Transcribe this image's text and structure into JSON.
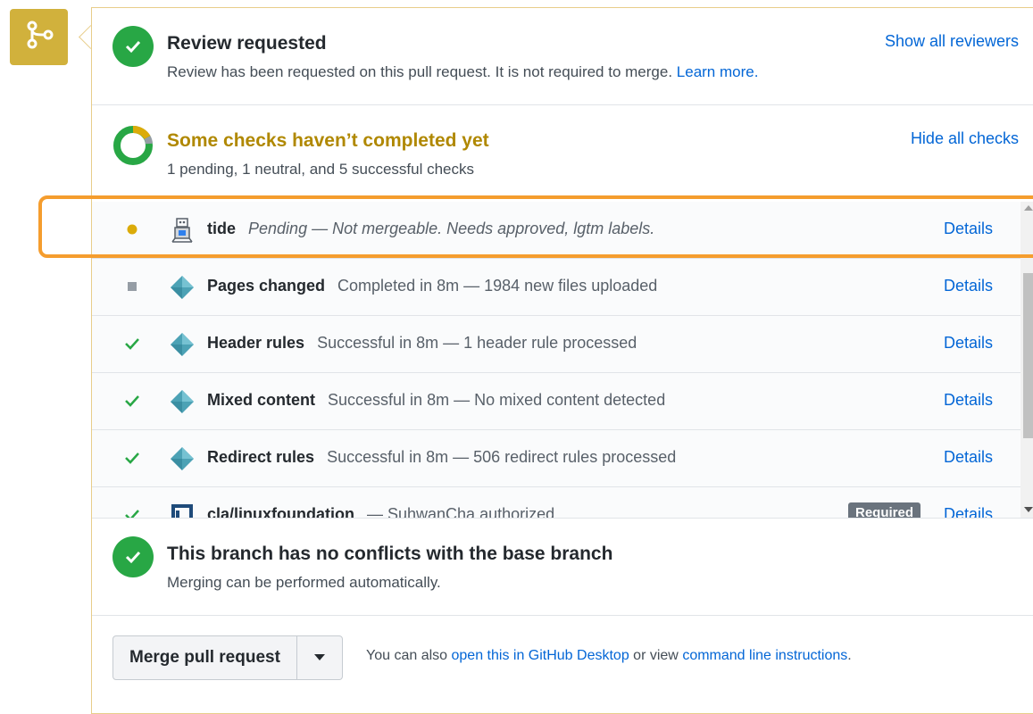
{
  "review": {
    "title": "Review requested",
    "subtitle": "Review has been requested on this pull request. It is not required to merge.",
    "learn_more": "Learn more.",
    "show_all": "Show all reviewers"
  },
  "checks_summary": {
    "title": "Some checks haven’t completed yet",
    "subtitle": "1 pending, 1 neutral, and 5 successful checks",
    "hide_all": "Hide all checks"
  },
  "checks": [
    {
      "name": "tide",
      "description": "Pending — Not mergeable. Needs approved, lgtm labels.",
      "status": "pending",
      "details": "Details"
    },
    {
      "name": "Pages changed",
      "description": "Completed in 8m — 1984 new files uploaded",
      "status": "neutral",
      "details": "Details"
    },
    {
      "name": "Header rules",
      "description": "Successful in 8m — 1 header rule processed",
      "status": "success",
      "details": "Details"
    },
    {
      "name": "Mixed content",
      "description": "Successful in 8m — No mixed content detected",
      "status": "success",
      "details": "Details"
    },
    {
      "name": "Redirect rules",
      "description": "Successful in 8m — 506 redirect rules processed",
      "status": "success",
      "details": "Details"
    },
    {
      "name": "cla/linuxfoundation",
      "description": "— SuhwanCha authorized",
      "status": "success",
      "details": "Details",
      "badge": "Required"
    }
  ],
  "conflicts": {
    "title": "This branch has no conflicts with the base branch",
    "subtitle": "Merging can be performed automatically."
  },
  "merge": {
    "button": "Merge pull request",
    "note_prefix": "You can also",
    "desktop_link": "open this in GitHub Desktop",
    "note_middle": "or view",
    "cli_link": "command line instructions",
    "note_suffix": "."
  },
  "colors": {
    "success": "#28a745",
    "pending": "#dbab09",
    "neutral": "#959da5",
    "link": "#0366d6",
    "merge_badge": "#d1b13c",
    "highlight": "#f59d2e",
    "pending_title": "#b08800"
  }
}
